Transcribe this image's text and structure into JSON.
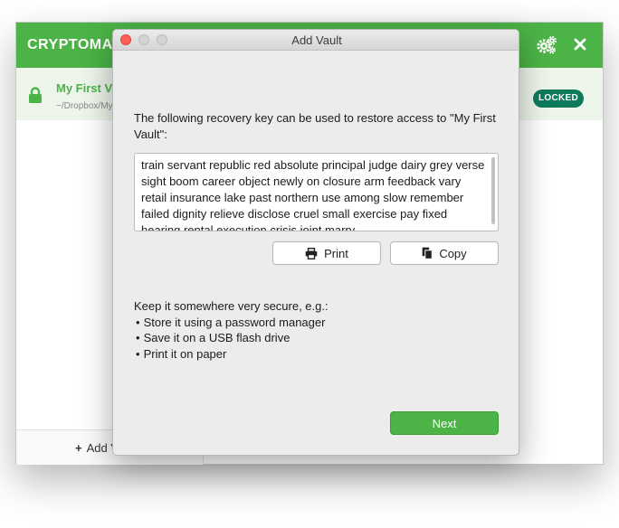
{
  "main_window": {
    "brand": "CRYPTOMATOR",
    "icons": {
      "settings": "gear-icon",
      "close": "close-icon",
      "lock": "lock-icon"
    },
    "vault": {
      "name": "My First Vault",
      "path": "~/Dropbox/My First Vault",
      "status": "LOCKED"
    },
    "footer": {
      "add_label": "Add Vault"
    },
    "colors": {
      "accent": "#4cb447",
      "locked_badge": "#0d7a5b"
    }
  },
  "dialog": {
    "title": "Add Vault",
    "intro": "The following recovery key can be used to restore access to \"My First Vault\":",
    "recovery_key": "train servant republic red absolute principal judge dairy grey verse sight boom career object newly on closure arm feedback vary retail insurance lake past northern use among slow remember failed dignity relieve disclose cruel small exercise pay fixed hearing rental execution crisis joint marry",
    "print_label": "Print",
    "copy_label": "Copy",
    "keep_heading": "Keep it somewhere very secure, e.g.:",
    "tips": [
      "Store it using a password manager",
      "Save it on a USB flash drive",
      "Print it on paper"
    ],
    "next_label": "Next",
    "icons": {
      "print": "printer-icon",
      "copy": "copy-icon"
    }
  }
}
